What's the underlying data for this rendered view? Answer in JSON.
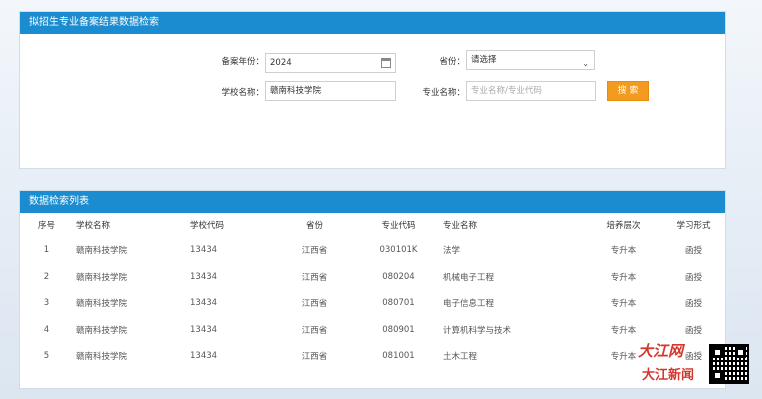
{
  "search": {
    "title": "拟招生专业备案结果数据检索",
    "year_label": "备案年份：",
    "year_value": "2024",
    "province_label": "省份：",
    "province_value": "请选择",
    "school_label": "学校名称：",
    "school_value": "赣南科技学院",
    "major_label": "专业名称：",
    "major_placeholder": "专业名称/专业代码",
    "search_button": "搜 索"
  },
  "results": {
    "title": "数据检索列表",
    "columns": [
      "序号",
      "学校名称",
      "学校代码",
      "省份",
      "专业代码",
      "专业名称",
      "培养层次",
      "学习形式"
    ],
    "rows": [
      [
        "1",
        "赣南科技学院",
        "13434",
        "江西省",
        "030101K",
        "法学",
        "专升本",
        "函授"
      ],
      [
        "2",
        "赣南科技学院",
        "13434",
        "江西省",
        "080204",
        "机械电子工程",
        "专升本",
        "函授"
      ],
      [
        "3",
        "赣南科技学院",
        "13434",
        "江西省",
        "080701",
        "电子信息工程",
        "专升本",
        "函授"
      ],
      [
        "4",
        "赣南科技学院",
        "13434",
        "江西省",
        "080901",
        "计算机科学与技术",
        "专升本",
        "函授"
      ],
      [
        "5",
        "赣南科技学院",
        "13434",
        "江西省",
        "081001",
        "土木工程",
        "专升本",
        "函授"
      ]
    ]
  },
  "watermark": {
    "line1": "大江网",
    "line2": "大江新闻"
  },
  "colors": {
    "header_blue": "#1b8ccf",
    "button_orange": "#f39b20"
  }
}
